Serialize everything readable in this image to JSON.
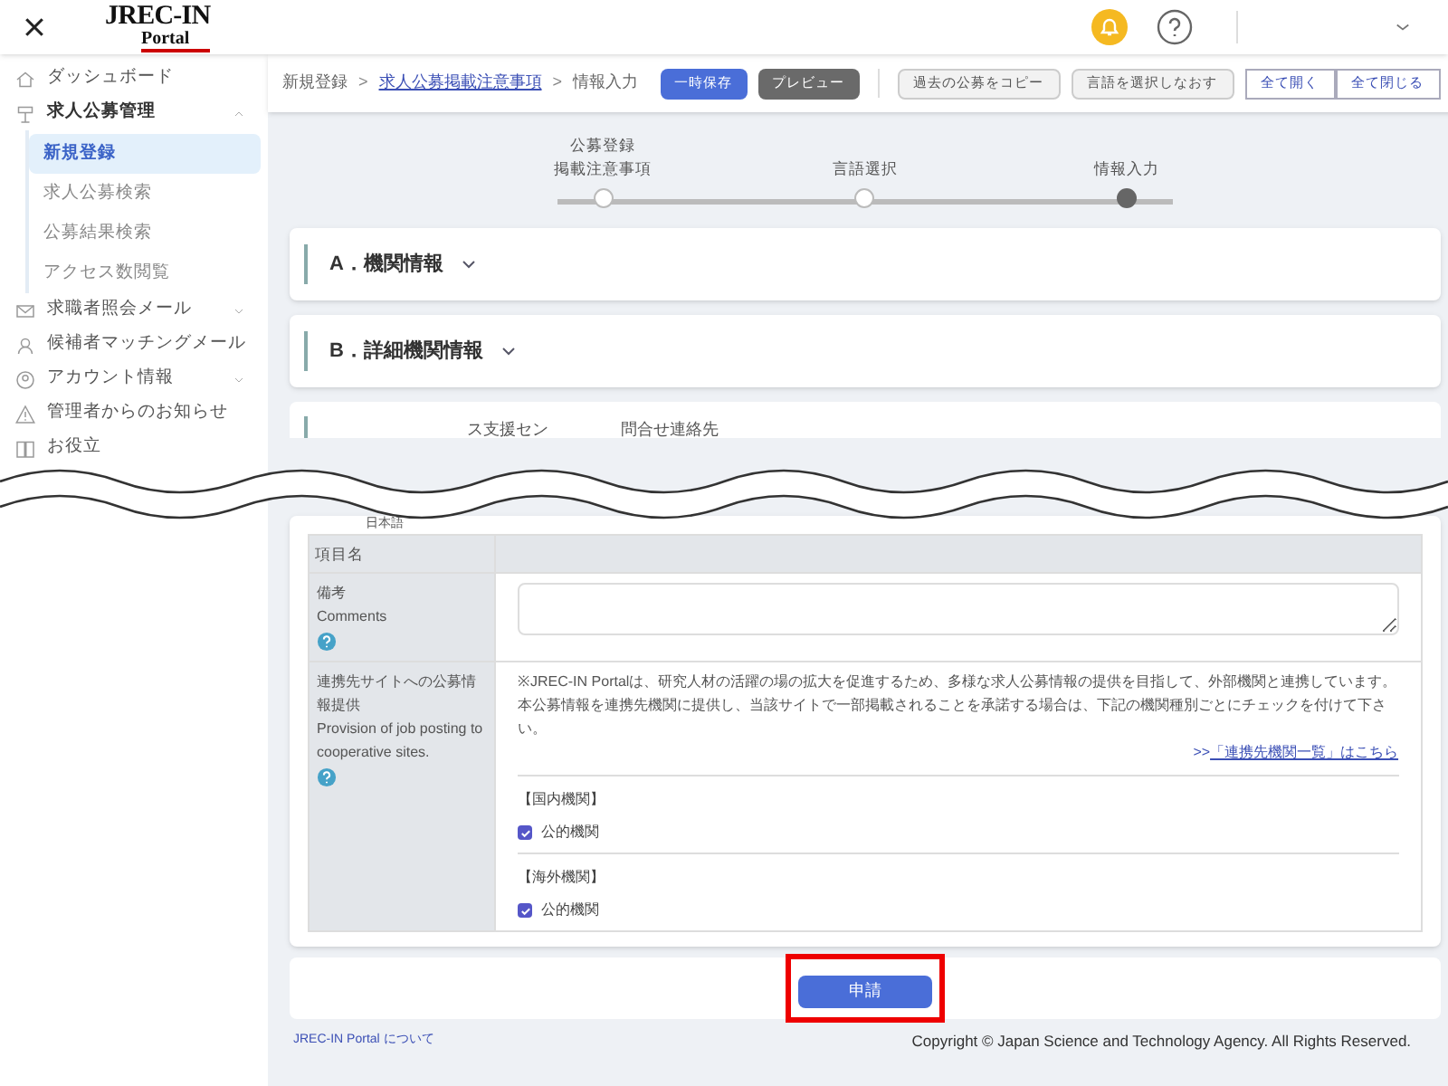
{
  "header": {
    "logo_main": "JREC-IN",
    "logo_sub": "Portal"
  },
  "sidebar": {
    "items": [
      {
        "label": "ダッシュボード",
        "selected": false
      },
      {
        "label": "求人公募管理",
        "expanded": true,
        "selected": false,
        "children": [
          {
            "label": "新規登録",
            "selected": true
          },
          {
            "label": "求人公募検索",
            "selected": false
          },
          {
            "label": "公募結果検索",
            "selected": false
          },
          {
            "label": "アクセス数閲覧",
            "selected": false
          }
        ]
      },
      {
        "label": "求職者照会メール",
        "expanded": false,
        "selected": false
      },
      {
        "label": "候補者マッチングメール",
        "expanded": false,
        "selected": false
      },
      {
        "label": "アカウント情報",
        "expanded": false,
        "selected": false
      },
      {
        "label": "管理者からのお知らせ",
        "selected": false
      },
      {
        "label": "お役立",
        "selected": false
      }
    ]
  },
  "breadcrumb": [
    {
      "label": "新規登録",
      "link": false
    },
    {
      "separator": ">",
      "label": "求人公募掲載注意事項",
      "link": true
    },
    {
      "separator": ">",
      "label": "情報入力",
      "link": false
    }
  ],
  "toolbar_buttons": [
    {
      "label": "一時保存",
      "kind": "primary"
    },
    {
      "label": "プレビュー",
      "kind": "dark"
    },
    {
      "label": "過去の公募をコピー",
      "kind": "plain"
    },
    {
      "label": "言語を選択しなおす",
      "kind": "plain"
    },
    {
      "label": "全て開く",
      "kind": "outline"
    },
    {
      "label": "全て閉じる",
      "kind": "outline"
    }
  ],
  "stepper": [
    {
      "lines": [
        "公募登録",
        "掲載注意事項"
      ],
      "current": false
    },
    {
      "lines": [
        "言語選択"
      ],
      "current": false
    },
    {
      "lines": [
        "情報入力"
      ],
      "current": true
    }
  ],
  "sections": [
    {
      "label": "A．機関情報",
      "expanded": false
    },
    {
      "label": "B．詳細機関情報",
      "expanded": false
    }
  ],
  "section_c_fragments": [
    "ス支援セン",
    "問合せ連絡先"
  ],
  "form": {
    "tab_label": "日本語",
    "header_cell": "項目名",
    "comments": {
      "label_ja": "備考",
      "label_en": "Comments"
    },
    "provision": {
      "label_ja": "連携先サイトへの公募情報提供",
      "label_en": "Provision of job posting to cooperative sites.",
      "notice": "※JREC-IN Portalは、研究人材の活躍の場の拡大を促進するため、多様な求人公募情報の提供を目指して、外部機関と連携しています。本公募情報を連携先機関に提供し、当該サイトで一部掲載されることを承諾する場合は、下記の機関種別ごとにチェックを付けて下さい。",
      "link_prefix": ">>",
      "link": "「連携先機関一覧」はこちら",
      "groups": [
        {
          "title": "【国内機関】",
          "option": "公的機関",
          "checked": true
        },
        {
          "title": "【海外機関】",
          "option": "公的機関",
          "checked": true
        }
      ]
    }
  },
  "submit": "申請",
  "footer": {
    "about": "JREC-IN Portal について",
    "copyright": "Copyright © Japan Science and Technology Agency. All Rights Reserved."
  }
}
